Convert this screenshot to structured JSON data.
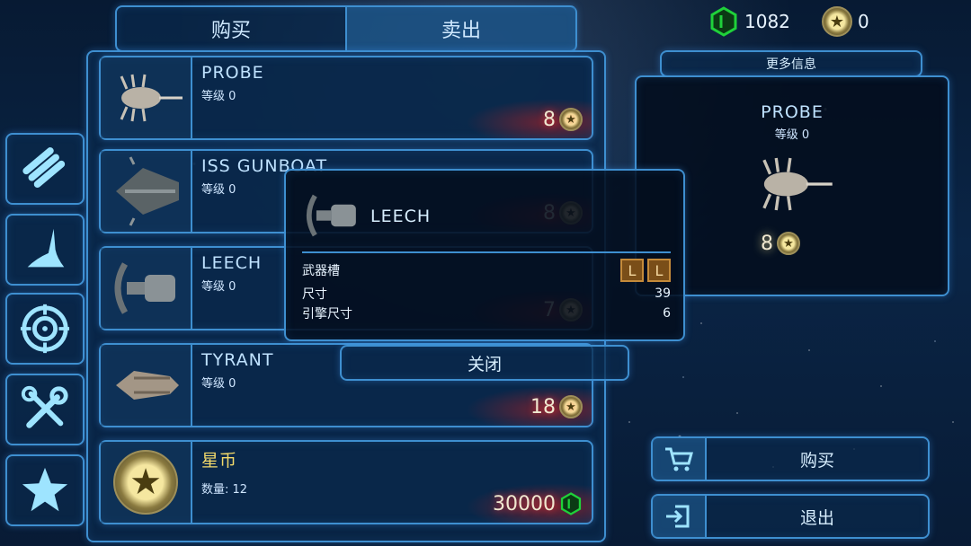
{
  "tabs": {
    "buy": "购买",
    "sell": "卖出"
  },
  "currency": {
    "credits": "1082",
    "stars": "0"
  },
  "side_tabs": [
    {
      "icon": "ammo-bundle-icon"
    },
    {
      "icon": "ship-hull-icon"
    },
    {
      "icon": "target-icon"
    },
    {
      "icon": "tools-icon"
    },
    {
      "icon": "star-icon"
    }
  ],
  "items": [
    {
      "name": "PROBE",
      "level": "等级 0",
      "price": "8",
      "price_icon": "star-coin-icon"
    },
    {
      "name": "ISS GUNBOAT",
      "level": "等级 0",
      "price": "8",
      "price_icon": "star-coin-icon"
    },
    {
      "name": "LEECH",
      "level": "等级 0",
      "price": "7",
      "price_icon": "star-coin-icon"
    },
    {
      "name": "TYRANT",
      "level": "等级 0",
      "price": "18",
      "price_icon": "star-coin-icon"
    },
    {
      "name": "星币",
      "level": "数量: 12",
      "price": "30000",
      "price_icon": "credit-hex-icon"
    }
  ],
  "info": {
    "more_info_label": "更多信息",
    "name": "PROBE",
    "level": "等级 0",
    "price": "8"
  },
  "popup": {
    "name": "LEECH",
    "weapon_slots_label": "武器槽",
    "weapon_slots": [
      "L",
      "L"
    ],
    "size_label": "尺寸",
    "size_value": "39",
    "engine_size_label": "引擎尺寸",
    "engine_size_value": "6",
    "close_label": "关闭"
  },
  "buttons": {
    "buy": "购买",
    "exit": "退出"
  },
  "colors": {
    "accent": "#3e8fd0",
    "credit": "#1fd13a",
    "star": "#f5e7a0",
    "slot": "#7a4e18"
  }
}
